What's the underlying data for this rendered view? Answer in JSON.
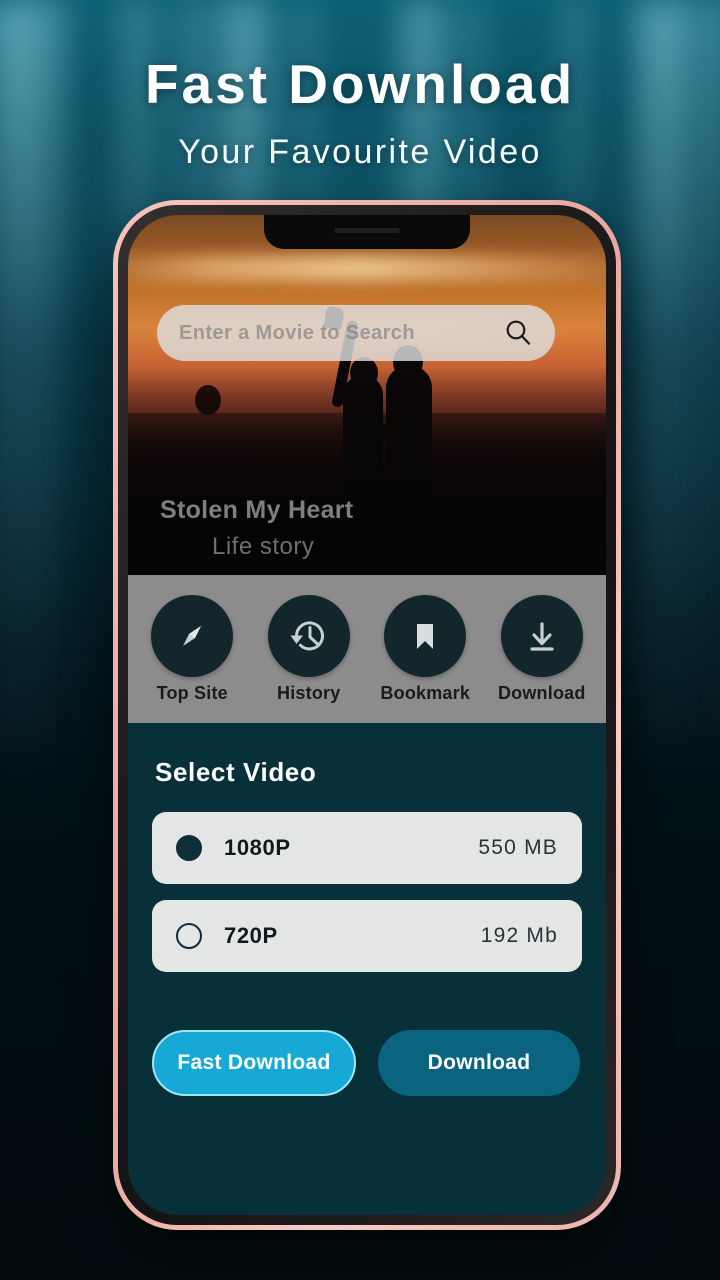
{
  "promo": {
    "headline": "Fast Download",
    "subheadline": "Your Favourite Video"
  },
  "phone": {
    "search": {
      "placeholder": "Enter a Movie to Search",
      "value": "",
      "icon": "search-icon"
    },
    "featured": {
      "title": "Stolen My Heart",
      "subtitle": "Life story"
    },
    "quick_actions": [
      {
        "label": "Top Site",
        "icon": "compass-icon"
      },
      {
        "label": "History",
        "icon": "history-clock-icon"
      },
      {
        "label": "Bookmark",
        "icon": "bookmark-icon"
      },
      {
        "label": "Download",
        "icon": "download-icon"
      }
    ],
    "select_video": {
      "heading": "Select Video",
      "options": [
        {
          "quality": "1080P",
          "size": "550 MB",
          "selected": true
        },
        {
          "quality": "720P",
          "size": "192 Mb",
          "selected": false
        }
      ],
      "buttons": {
        "primary": "Fast Download",
        "secondary": "Download"
      }
    }
  },
  "colors": {
    "panel_bg": "#083039",
    "icon_circle": "#12262b",
    "icon_bar_bg": "#8c8c8c",
    "primary_button": "#16a9d6",
    "primary_button_border": "#9fe6f7",
    "secondary_button": "#0a6480",
    "option_row_bg": "#e3e6e5",
    "phone_frame": "#f3b2ab",
    "background_top": "#0d5f74",
    "background_bottom": "#020b0e"
  }
}
